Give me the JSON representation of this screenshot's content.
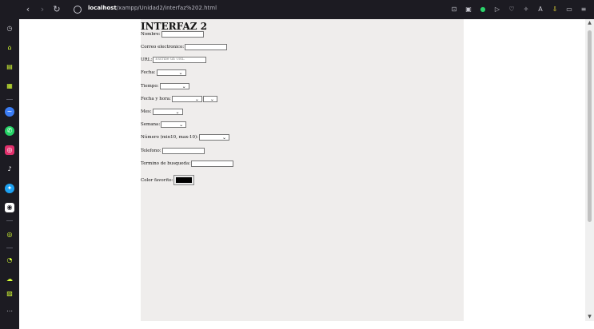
{
  "browser": {
    "url_host": "localhost",
    "url_path": "/xampp/Unidad2/interfaz%202.html"
  },
  "page": {
    "title": "INTERFAZ 2",
    "fields": [
      {
        "label": "Nombre:"
      },
      {
        "label": "Correo electronico:"
      },
      {
        "label": "URL:",
        "placeholder": "Escribe un URL"
      },
      {
        "label": "Fecha:"
      },
      {
        "label": "Tiempo:"
      },
      {
        "label": "Fecha y hora:"
      },
      {
        "label": "Mes:"
      },
      {
        "label": "Semana:"
      },
      {
        "label": "Número (min10, max-10):"
      },
      {
        "label": "Telefono:"
      },
      {
        "label": "Termino de busqueda:"
      },
      {
        "label": "Color favorito:",
        "color_value": "#000000"
      }
    ]
  }
}
